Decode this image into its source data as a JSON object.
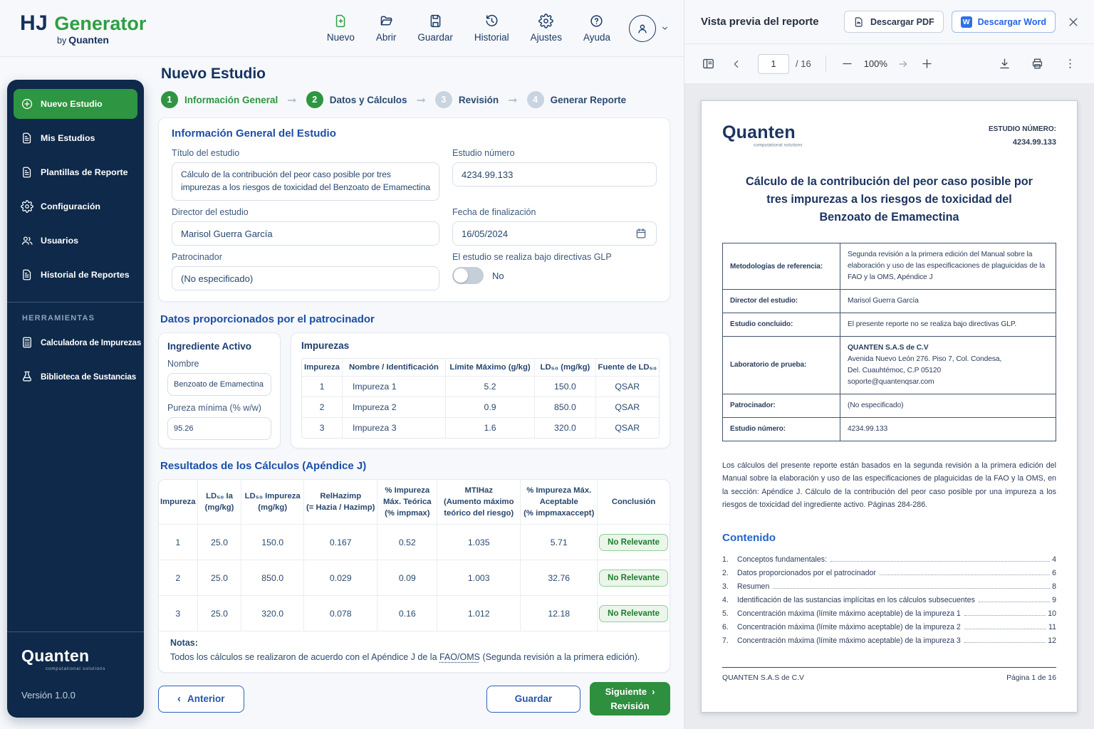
{
  "app": {
    "logo": {
      "hj": "HJ",
      "generator": "Generator",
      "by": "by",
      "brand": "Quanten"
    },
    "nav": [
      {
        "label": "Nuevo"
      },
      {
        "label": "Abrir"
      },
      {
        "label": "Guardar"
      },
      {
        "label": "Historial"
      },
      {
        "label": "Ajustes"
      },
      {
        "label": "Ayuda"
      }
    ]
  },
  "sidebar": {
    "items": [
      {
        "label": "Nuevo Estudio"
      },
      {
        "label": "Mis Estudios"
      },
      {
        "label": "Plantillas de Reporte"
      },
      {
        "label": "Configuración"
      },
      {
        "label": "Usuarios"
      },
      {
        "label": "Historial de Reportes"
      }
    ],
    "tools_heading": "HERRAMIENTAS",
    "tools": [
      {
        "label": "Calculadora de Impurezas"
      },
      {
        "label": "Biblioteca de Sustancias"
      }
    ],
    "brand": "Quanten",
    "brand_tagline": "computational solutions",
    "version": "Versión 1.0.0"
  },
  "main": {
    "title": "Nuevo Estudio",
    "steps": [
      {
        "num": "1",
        "label": "Información General"
      },
      {
        "num": "2",
        "label": "Datos y Cálculos"
      },
      {
        "num": "3",
        "label": "Revisión"
      },
      {
        "num": "4",
        "label": "Generar Reporte"
      }
    ],
    "general": {
      "heading": "Información General del Estudio",
      "titulo_label": "Título del estudio",
      "titulo_value": "Cálculo de la contribución del peor caso posible por tres impurezas a los riesgos de toxicidad del Benzoato de Emamectina",
      "numero_label": "Estudio número",
      "numero_value": "4234.99.133",
      "director_label": "Director del estudio",
      "director_value": "Marisol Guerra García",
      "fecha_label": "Fecha de finalización",
      "fecha_value": "16/05/2024",
      "patrocinador_label": "Patrocinador",
      "patrocinador_value": "(No especificado)",
      "glp_label": "El estudio se realiza bajo directivas GLP",
      "glp_state": "No"
    },
    "sponsor": {
      "heading": "Datos proporcionados por el patrocinador",
      "ingredient": {
        "title": "Ingrediente Activo",
        "nombre_label": "Nombre",
        "nombre_value": "Benzoato de Emamectina",
        "pureza_label": "Pureza mínima (% w/w)",
        "pureza_value": "95.26"
      },
      "impurities": {
        "title": "Impurezas",
        "headers": [
          "Impureza",
          "Nombre / Identificación",
          "Límite Máximo (g/kg)",
          "LD₅₀ (mg/kg)",
          "Fuente de LD₅₀"
        ],
        "rows": [
          [
            "1",
            "Impureza 1",
            "5.2",
            "150.0",
            "QSAR"
          ],
          [
            "2",
            "Impureza 2",
            "0.9",
            "850.0",
            "QSAR"
          ],
          [
            "3",
            "Impureza 3",
            "1.6",
            "320.0",
            "QSAR"
          ]
        ]
      }
    },
    "results": {
      "heading": "Resultados de los Cálculos (Apéndice J)",
      "headers": [
        "Impureza",
        "LD₅₀ Ia\n(mg/kg)",
        "LD₅₀ Impureza\n(mg/kg)",
        "RelHazimp\n(= Hazia / Hazimp)",
        "% Impureza\nMáx. Teórica\n(% impmax)",
        "MTIHaz\n(Aumento máximo\nteórico del riesgo)",
        "% Impureza Máx.\nAceptable\n(% impmaxaccept)",
        "Conclusión"
      ],
      "rows": [
        {
          "c": [
            "1",
            "25.0",
            "150.0",
            "0.167",
            "0.52",
            "1.035",
            "5.71"
          ],
          "badge": "No Relevante"
        },
        {
          "c": [
            "2",
            "25.0",
            "850.0",
            "0.029",
            "0.09",
            "1.003",
            "32.76"
          ],
          "badge": "No Relevante"
        },
        {
          "c": [
            "3",
            "25.0",
            "320.0",
            "0.078",
            "0.16",
            "1.012",
            "12.18"
          ],
          "badge": "No Relevante"
        }
      ],
      "notes_label": "Notas:",
      "notes_before": "Todos los cálculos se realizaron de acuerdo con el Apéndice J de la ",
      "notes_link": "FAO/OMS",
      "notes_after": " (Segunda revisión a la primera edición)."
    },
    "actions": {
      "anterior": "Anterior",
      "guardar": "Guardar",
      "siguiente": "Siguiente",
      "siguiente_sub": "Revisión"
    }
  },
  "preview": {
    "title": "Vista previa del reporte",
    "download_pdf": "Descargar PDF",
    "download_word": "Descargar Word",
    "toolbar": {
      "page": "1",
      "total": "/ 16",
      "zoom": "100%"
    },
    "page": {
      "logo": "Quanten",
      "logo_tagline": "computational solutions",
      "study_label": "ESTUDIO NÚMERO:",
      "study_value": "4234.99.133",
      "title": "Cálculo de la contribución del peor caso posible por tres impurezas a los riesgos de toxicidad del Benzoato de Emamectina",
      "meta": [
        {
          "label": "Metodologías de referencia:",
          "value": "Segunda revisión a la primera edición del Manual sobre la elaboración y uso de las especificaciones de plaguicidas de la FAO y la OMS, Apéndice J"
        },
        {
          "label": "Director del estudio:",
          "value": "Marisol Guerra García"
        },
        {
          "label": "Estudio concluido:",
          "value": "El presente reporte no se realiza bajo directivas GLP."
        },
        {
          "label": "Laboratorio de prueba:",
          "value_bold": "QUANTEN S.A.S de C.V",
          "value": "Avenida Nuevo León 276. Piso 7, Col. Condesa,\nDel. Cuauhtémoc, C.P 05120\nsoporte@quantenqsar.com"
        },
        {
          "label": "Patrocinador:",
          "value": "(No especificado)"
        },
        {
          "label": "Estudio número:",
          "value": "4234.99.133"
        }
      ],
      "body": "Los cálculos del presente reporte están basados en la segunda revisión a la primera edición del Manual sobre la elaboración y uso de las especificaciones de plaguicidas de la FAO y la OMS, en la sección: Apéndice J. Cálculo de la contribución del peor caso posible por una impureza a los riesgos de toxicidad del ingrediente activo. Páginas 284-286.",
      "toc_title": "Contenido",
      "toc": [
        {
          "num": "1.",
          "label": "Conceptos fundamentales:",
          "page": "4"
        },
        {
          "num": "2.",
          "label": "Datos proporcionados por el patrocinador",
          "page": "6"
        },
        {
          "num": "3.",
          "label": "Resumen",
          "page": "8"
        },
        {
          "num": "4.",
          "label": "Identificación de las sustancias implícitas en los cálculos subsecuentes",
          "page": "9"
        },
        {
          "num": "5.",
          "label": "Concentración máxima (límite máximo aceptable) de la impureza 1",
          "page": "10"
        },
        {
          "num": "6.",
          "label": "Concentración máxima (límite máximo aceptable) de la impureza 2",
          "page": "11"
        },
        {
          "num": "7.",
          "label": "Concentración máxima (límite máximo aceptable) de la impureza 3",
          "page": "12"
        }
      ],
      "footer_left": "QUANTEN S.A.S de C.V",
      "footer_right": "Página 1 de 16"
    }
  }
}
